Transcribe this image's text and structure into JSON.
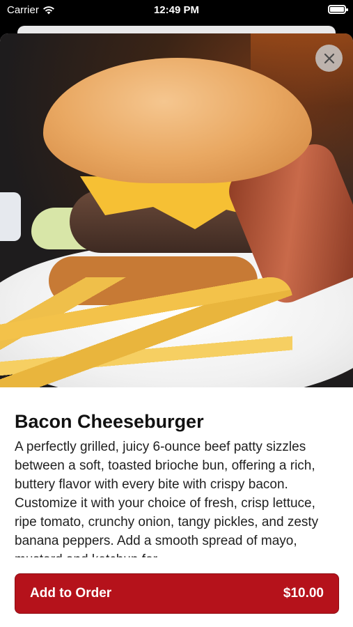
{
  "status_bar": {
    "carrier": "Carrier",
    "time": "12:49 PM"
  },
  "item": {
    "title": "Bacon Cheeseburger",
    "description": "A perfectly grilled, juicy 6-ounce beef patty sizzles between a soft, toasted brioche bun, offering a rich, buttery flavor with every bite with crispy bacon. Customize it with your choice of fresh, crisp lettuce, ripe tomato, crunchy onion, tangy pickles, and zesty banana peppers. Add a smooth spread of mayo, mustard and ketchup for"
  },
  "actions": {
    "add_label": "Add to Order",
    "price": "$10.00"
  },
  "icons": {
    "close": "close-icon",
    "wifi": "wifi-icon",
    "battery": "battery-icon"
  },
  "colors": {
    "accent": "#b5121b"
  }
}
